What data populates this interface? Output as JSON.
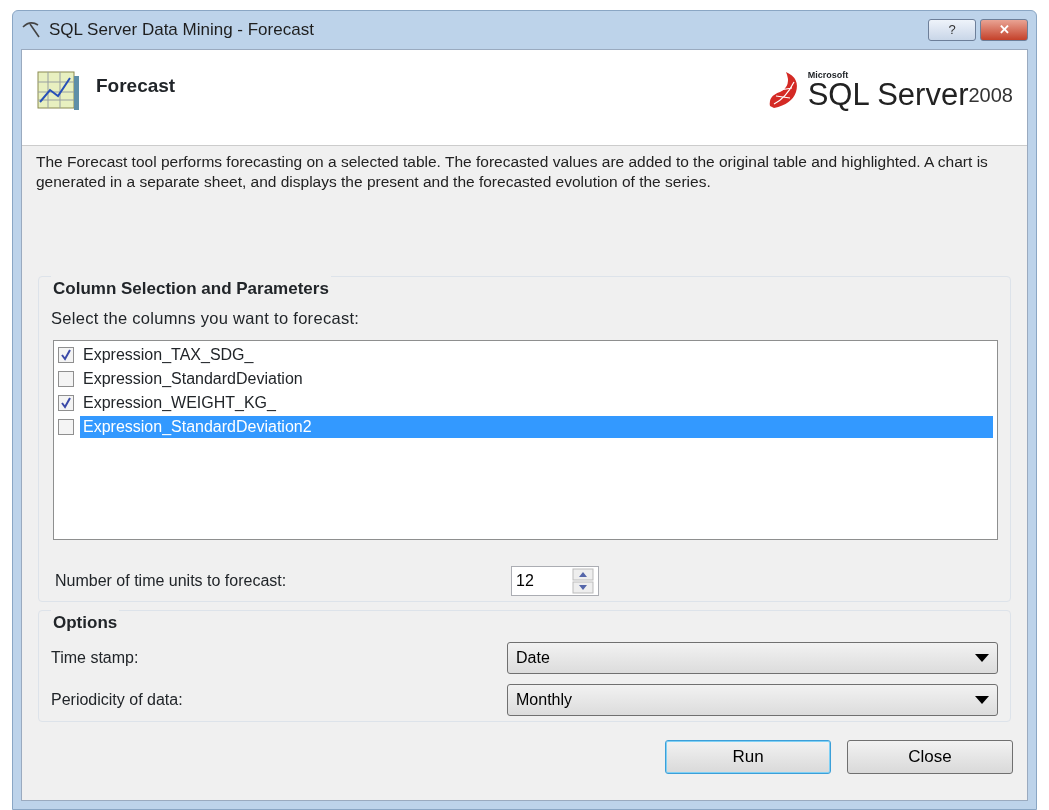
{
  "window": {
    "title": "SQL Server Data Mining - Forecast",
    "controls": [
      "?",
      "✕"
    ]
  },
  "header": {
    "title": "Forecast",
    "logo": {
      "vendor": "Microsoft",
      "product": "SQL Server",
      "version": "2008"
    }
  },
  "description": "The Forecast tool performs forecasting on a selected table. The forecasted values are added to the original table and highlighted. A chart is generated in a separate sheet, and displays the present and the forecasted evolution of the series.",
  "column_group": {
    "title": "Column Selection and Parameters",
    "prompt": "Select the columns you want to forecast:",
    "columns": [
      {
        "label": "Expression_TAX_SDG_",
        "checked": true,
        "selected": false
      },
      {
        "label": "Expression_StandardDeviation",
        "checked": false,
        "selected": false
      },
      {
        "label": "Expression_WEIGHT_KG_",
        "checked": true,
        "selected": false
      },
      {
        "label": "Expression_StandardDeviation2",
        "checked": false,
        "selected": true
      }
    ],
    "time_units": {
      "label": "Number of time units to forecast:",
      "value": "12"
    }
  },
  "options": {
    "title": "Options",
    "fields": [
      {
        "label": "Time stamp:",
        "value": "Date"
      },
      {
        "label": "Periodicity of data:",
        "value": "Monthly"
      }
    ]
  },
  "buttons": [
    {
      "label": "Run",
      "default": true
    },
    {
      "label": "Close",
      "default": false
    }
  ]
}
